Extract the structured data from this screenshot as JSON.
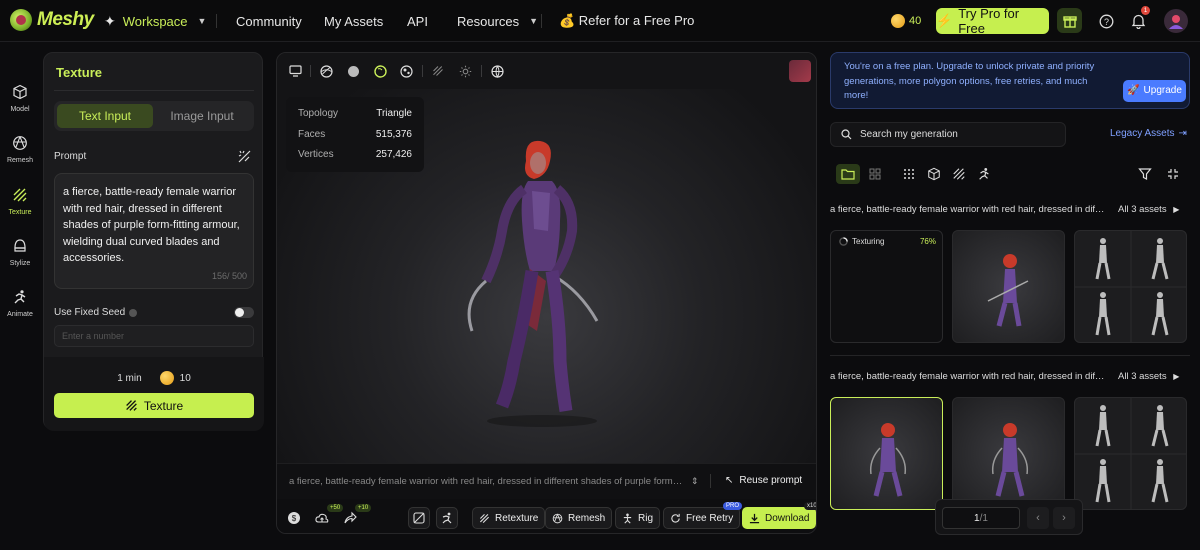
{
  "brand": {
    "name": "Meshy"
  },
  "nav": {
    "workspace": "Workspace",
    "community": "Community",
    "my_assets": "My Assets",
    "api": "API",
    "resources": "Resources",
    "refer": "💰 Refer for a Free Pro",
    "credits": "40",
    "try_pro": "Try Pro for Free",
    "notif_count": "1"
  },
  "sidebar": {
    "items": [
      {
        "label": "Model",
        "icon": "cube-icon"
      },
      {
        "label": "Remesh",
        "icon": "remesh-icon"
      },
      {
        "label": "Texture",
        "icon": "texture-icon"
      },
      {
        "label": "Stylize",
        "icon": "stylize-icon"
      },
      {
        "label": "Animate",
        "icon": "animate-icon"
      }
    ]
  },
  "texture_panel": {
    "title": "Texture",
    "tab_text": "Text Input",
    "tab_image": "Image Input",
    "prompt_label": "Prompt",
    "prompt_value": "a fierce, battle-ready female warrior with red hair, dressed in different shades of purple form-fitting armour, wielding dual curved blades and accessories.",
    "char_count": "156/ 500",
    "seed_label": "Use Fixed Seed",
    "seed_placeholder": "Enter a number",
    "time": "1 min",
    "cost": "10",
    "submit_label": "Texture"
  },
  "viewer": {
    "stats": [
      {
        "label": "Topology",
        "value": "Triangle"
      },
      {
        "label": "Faces",
        "value": "515,376"
      },
      {
        "label": "Vertices",
        "value": "257,426"
      }
    ],
    "prompt_text": "a fierce, battle-ready female warrior with red hair, dressed in different shades of purple form-fitting armour, wielding dual curved blades and accessories.",
    "reuse_label": "Reuse prompt",
    "badges": {
      "plus50": "+50",
      "plus10": "+10",
      "pro": "PRO",
      "x10": "x10"
    },
    "actions": {
      "retexture": "Retexture",
      "remesh": "Remesh",
      "rig": "Rig",
      "free_retry": "Free Retry",
      "download": "Download"
    }
  },
  "right_panel": {
    "banner_text": "You're on a free plan. Upgrade to unlock private and priority generations, more polygon options, free retries, and much more!",
    "upgrade_label": "Upgrade",
    "search_placeholder": "Search my generation",
    "legacy_label": "Legacy Assets",
    "groups": [
      {
        "title": "a fierce, battle-ready female warrior with red hair, dressed in different shades of purple form-fitting armour",
        "all_label": "All 3 assets",
        "status": "Texturing",
        "progress_label": "76%",
        "progress": 0.76
      },
      {
        "title": "a fierce, battle-ready female warrior with red hair, dressed in different shades of purple form-fitting armour",
        "all_label": "All 3 assets"
      }
    ],
    "pager": {
      "current": "1",
      "total": "/1"
    }
  },
  "colors": {
    "accent": "#c6ef4f",
    "link": "#7fa0ff",
    "banner_bg": "#111a33"
  }
}
